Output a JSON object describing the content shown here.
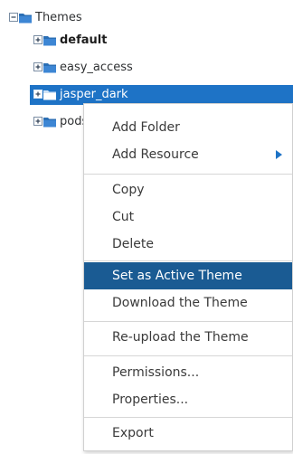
{
  "tree": {
    "root": {
      "label": "Themes",
      "expanded": true
    },
    "children": [
      {
        "label": "default",
        "bold": true,
        "selected": false
      },
      {
        "label": "easy_access",
        "bold": false,
        "selected": false
      },
      {
        "label": "jasper_dark",
        "bold": false,
        "selected": true
      },
      {
        "label": "pods",
        "bold": false,
        "selected": false,
        "partially_hidden": true
      }
    ]
  },
  "context_menu": {
    "items": [
      {
        "label": "Add Folder"
      },
      {
        "label": "Add Resource",
        "has_submenu": true
      },
      {
        "label": "Copy"
      },
      {
        "label": "Cut"
      },
      {
        "label": "Delete"
      },
      {
        "label": "Set as Active Theme",
        "highlighted": true
      },
      {
        "label": "Download the Theme"
      },
      {
        "label": "Re-upload the Theme"
      },
      {
        "label": "Permissions..."
      },
      {
        "label": "Properties..."
      },
      {
        "label": "Export"
      }
    ]
  },
  "colors": {
    "selection": "#1e73c6",
    "menu_highlight": "#1a5b93",
    "folder_icon": "#2b6fb5",
    "separator": "#d6d6d6"
  },
  "icons": {
    "expanded_root": "collapse-box-folder-icon",
    "collapsed_child": "expand-box-folder-icon",
    "submenu": "submenu-arrow-icon"
  }
}
